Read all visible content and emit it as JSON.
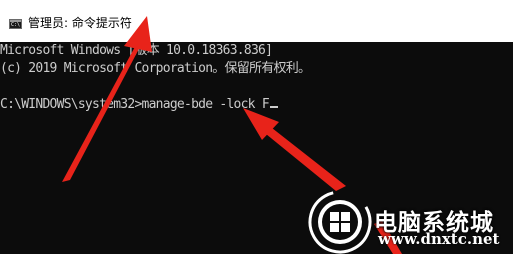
{
  "window": {
    "title": "管理员: 命令提示符",
    "icon": "cmd-app-icon"
  },
  "console": {
    "lines": [
      "Microsoft Windows [版本 10.0.18363.836]",
      "(c) 2019 Microsoft Corporation。保留所有权利。",
      "",
      "C:\\WINDOWS\\system32>manage-bde -lock F"
    ],
    "cursor": "_"
  },
  "annotations": {
    "arrow_color": "#e8231a"
  },
  "watermark": {
    "site_name": "电脑系统城",
    "url": "www.dnxtc.net",
    "logo_icon": "windows-logo-icon"
  }
}
